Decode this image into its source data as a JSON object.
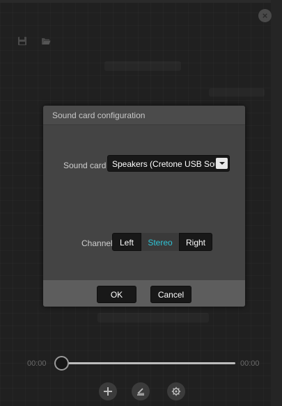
{
  "window": {
    "close_icon": "close-icon",
    "close_label": "×"
  },
  "toolbar": {
    "save_icon": "save-icon",
    "open_icon": "folder-open-icon"
  },
  "dialog": {
    "title": "Sound card configuration",
    "sound_card_label": "Sound card",
    "sound_card_value": "Speakers (Cretone USB Sound",
    "channel_label": "Channel",
    "channels": [
      "Left",
      "Stereo",
      "Right"
    ],
    "selected_channel": "Stereo",
    "ok_label": "OK",
    "cancel_label": "Cancel",
    "colors": {
      "selected_text": "#2fc4d6"
    }
  },
  "playback": {
    "time_start": "00:00",
    "time_end": "00:00",
    "progress": 0
  },
  "controls": {
    "add_icon": "plus-icon",
    "equalizer_icon": "equalizer-icon",
    "settings_icon": "gear-icon"
  }
}
